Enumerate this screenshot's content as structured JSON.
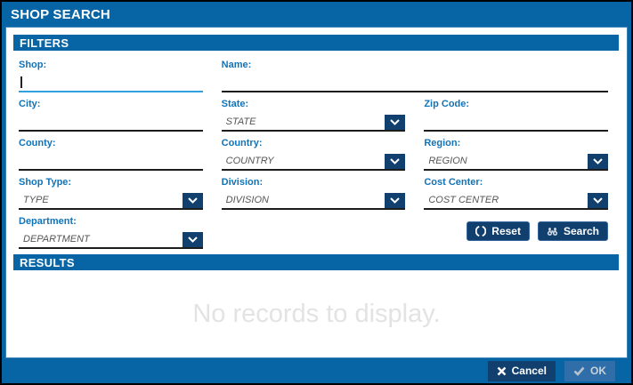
{
  "window": {
    "title": "SHOP SEARCH"
  },
  "filters": {
    "header": "FILTERS",
    "fields": {
      "shop": {
        "label": "Shop:",
        "value": ""
      },
      "name": {
        "label": "Name:",
        "value": ""
      },
      "city": {
        "label": "City:",
        "value": ""
      },
      "state": {
        "label": "State:",
        "value": "STATE"
      },
      "zip": {
        "label": "Zip Code:",
        "value": ""
      },
      "county": {
        "label": "County:",
        "value": ""
      },
      "country": {
        "label": "Country:",
        "value": "COUNTRY"
      },
      "region": {
        "label": "Region:",
        "value": "REGION"
      },
      "shop_type": {
        "label": "Shop Type:",
        "value": "TYPE"
      },
      "division": {
        "label": "Division:",
        "value": "DIVISION"
      },
      "cost_center": {
        "label": "Cost Center:",
        "value": "COST CENTER"
      },
      "department": {
        "label": "Department:",
        "value": "DEPARTMENT"
      }
    },
    "buttons": {
      "reset": "Reset",
      "search": "Search"
    }
  },
  "results": {
    "header": "RESULTS",
    "empty_message": "No records to display."
  },
  "footer": {
    "cancel": "Cancel",
    "ok": "OK"
  },
  "colors": {
    "primary_blue": "#0765A6",
    "navy": "#11406F",
    "label_blue": "#1173B8",
    "focused_underline": "#31A2DF",
    "underline": "#1c1c1c",
    "empty_text": "#e3e3e3"
  }
}
